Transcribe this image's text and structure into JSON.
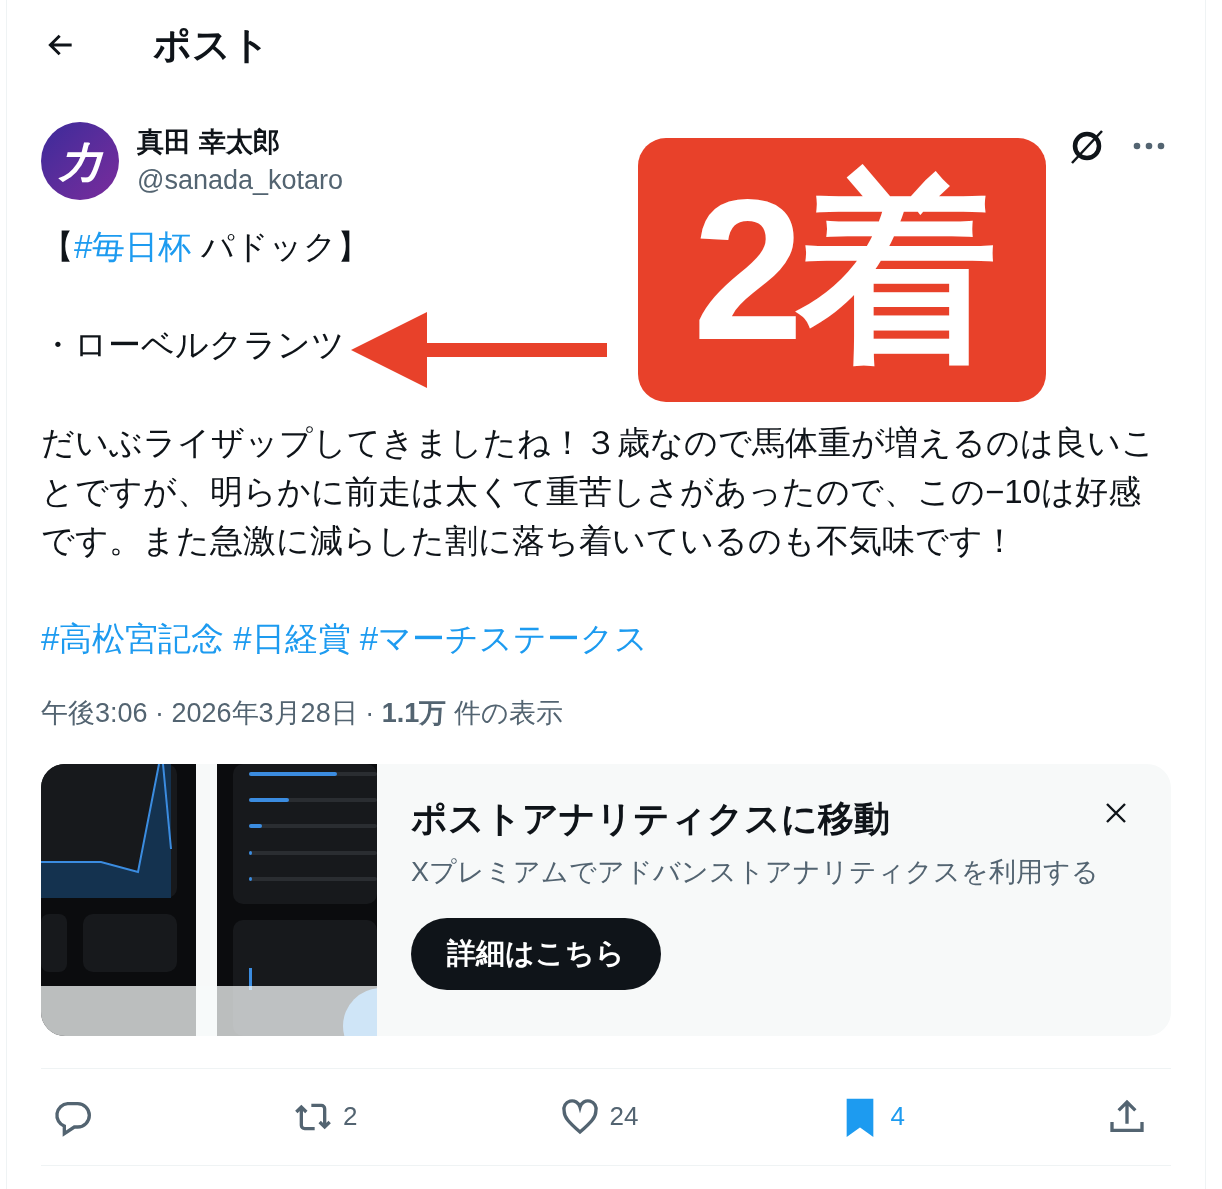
{
  "header": {
    "title": "ポスト"
  },
  "post": {
    "author": {
      "name": "真田 幸太郎",
      "handle": "@sanada_kotaro",
      "avatar_glyph": "カ"
    },
    "paragraphs": [
      {
        "kind": "text",
        "spans": [
          {
            "kind": "plain",
            "text": "【"
          },
          {
            "kind": "hashtag",
            "text": "#毎日杯"
          },
          {
            "kind": "plain",
            "text": " パドック】"
          }
        ]
      },
      {
        "kind": "text",
        "spans": [
          {
            "kind": "plain",
            "text": "・ローベルクランツ"
          }
        ]
      },
      {
        "kind": "text",
        "spans": [
          {
            "kind": "plain",
            "text": "だいぶライザップしてきましたね！３歳なので馬体重が増えるのは良いことですが、明らかに前走は太くて重苦しさがあったので、この−10は好感です。また急激に減らした割に落ち着いているのも不気味です！"
          }
        ]
      },
      {
        "kind": "tags",
        "spans": [
          {
            "kind": "hashtag",
            "text": "#高松宮記念"
          },
          {
            "kind": "hashtag",
            "text": "#日経賞"
          },
          {
            "kind": "hashtag",
            "text": "#マーチステークス"
          }
        ]
      }
    ],
    "meta": "午後3:06 · 2026年3月28日 · **1.1万** 件の表示",
    "promo": {
      "title": "ポストアナリティクスに移動",
      "subtitle": "Xプレミアムでアドバンストアナリティクスを利用する",
      "button": "詳細はこちら"
    },
    "actions": [
      {
        "kind": "reply",
        "selected": false
      },
      {
        "kind": "repost",
        "count": "2",
        "selected": false
      },
      {
        "kind": "like",
        "count": "24",
        "selected": false
      },
      {
        "kind": "bookmark",
        "count": "4",
        "selected": true
      },
      {
        "kind": "share",
        "selected": false
      }
    ]
  },
  "annotation": {
    "badge": "2着"
  }
}
